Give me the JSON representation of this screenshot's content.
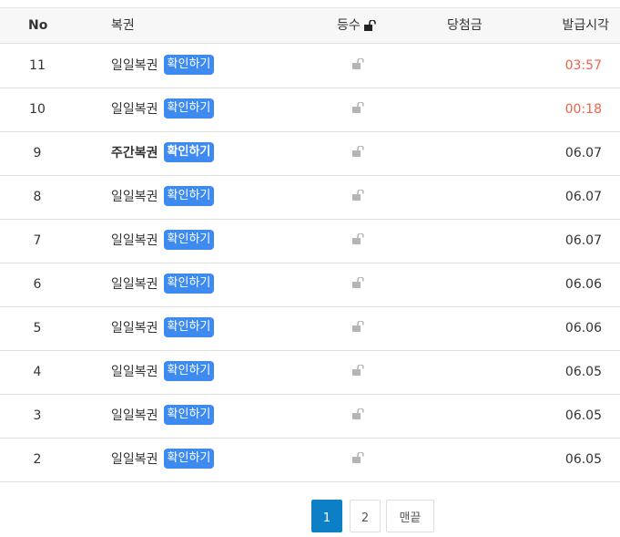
{
  "header": {
    "no": "No",
    "ticket": "복권",
    "rank": "등수",
    "prize": "당첨금",
    "time": "발급시각"
  },
  "rows": [
    {
      "no": "11",
      "ticket": "일일복권",
      "bold": false,
      "button": "확인하기",
      "time": "03:57",
      "time_color": "red"
    },
    {
      "no": "10",
      "ticket": "일일복권",
      "bold": false,
      "button": "확인하기",
      "time": "00:18",
      "time_color": "red"
    },
    {
      "no": "9",
      "ticket": "주간복권",
      "bold": true,
      "button": "확인하기",
      "time": "06.07",
      "time_color": "normal"
    },
    {
      "no": "8",
      "ticket": "일일복권",
      "bold": false,
      "button": "확인하기",
      "time": "06.07",
      "time_color": "normal"
    },
    {
      "no": "7",
      "ticket": "일일복권",
      "bold": false,
      "button": "확인하기",
      "time": "06.07",
      "time_color": "normal"
    },
    {
      "no": "6",
      "ticket": "일일복권",
      "bold": false,
      "button": "확인하기",
      "time": "06.06",
      "time_color": "normal"
    },
    {
      "no": "5",
      "ticket": "일일복권",
      "bold": false,
      "button": "확인하기",
      "time": "06.06",
      "time_color": "normal"
    },
    {
      "no": "4",
      "ticket": "일일복권",
      "bold": false,
      "button": "확인하기",
      "time": "06.05",
      "time_color": "normal"
    },
    {
      "no": "3",
      "ticket": "일일복권",
      "bold": false,
      "button": "확인하기",
      "time": "06.05",
      "time_color": "normal"
    },
    {
      "no": "2",
      "ticket": "일일복권",
      "bold": false,
      "button": "확인하기",
      "time": "06.05",
      "time_color": "normal"
    }
  ],
  "pagination": {
    "pages": [
      "1",
      "2"
    ],
    "active": "1",
    "last": "맨끝"
  },
  "icons": {
    "header_lock": "lock-open-icon",
    "row_lock": "lock-open-icon"
  },
  "colors": {
    "button_bg": "#3d8bf0",
    "time_red": "#e8644a",
    "active_page": "#0c7fc6"
  }
}
